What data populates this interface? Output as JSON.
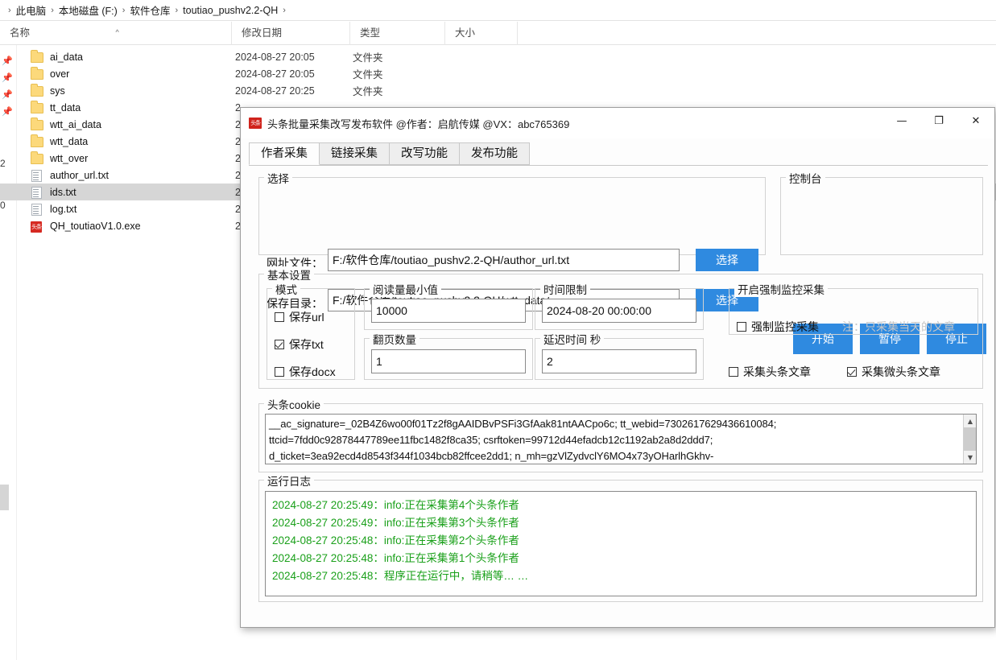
{
  "explorer": {
    "breadcrumb": [
      "此电脑",
      "本地磁盘 (F:)",
      "软件仓库",
      "toutiao_pushv2.2-QH"
    ],
    "columns": [
      {
        "label": "名称",
        "sorted": true
      },
      {
        "label": "修改日期",
        "sorted": false
      },
      {
        "label": "类型",
        "sorted": false
      },
      {
        "label": "大小",
        "sorted": false
      }
    ],
    "left_numbers": [
      "2",
      "0"
    ],
    "files": [
      {
        "name": "ai_data",
        "icon": "folder-icon",
        "date": "2024-08-27 20:05",
        "type": "文件夹",
        "size": "",
        "selected": false
      },
      {
        "name": "over",
        "icon": "folder-icon",
        "date": "2024-08-27 20:05",
        "type": "文件夹",
        "size": "",
        "selected": false
      },
      {
        "name": "sys",
        "icon": "folder-icon",
        "date": "2024-08-27 20:25",
        "type": "文件夹",
        "size": "",
        "selected": false
      },
      {
        "name": "tt_data",
        "icon": "folder-icon",
        "date": "2",
        "type": "",
        "size": "",
        "selected": false
      },
      {
        "name": "wtt_ai_data",
        "icon": "folder-icon",
        "date": "2",
        "type": "",
        "size": "",
        "selected": false
      },
      {
        "name": "wtt_data",
        "icon": "folder-icon",
        "date": "2",
        "type": "",
        "size": "",
        "selected": false
      },
      {
        "name": "wtt_over",
        "icon": "folder-icon",
        "date": "2",
        "type": "",
        "size": "",
        "selected": false
      },
      {
        "name": "author_url.txt",
        "icon": "text-file-icon",
        "date": "2",
        "type": "",
        "size": "",
        "selected": false
      },
      {
        "name": "ids.txt",
        "icon": "text-file-icon",
        "date": "2",
        "type": "",
        "size": "",
        "selected": true
      },
      {
        "name": "log.txt",
        "icon": "text-file-icon",
        "date": "2",
        "type": "",
        "size": "",
        "selected": false
      },
      {
        "name": "QH_toutiaoV1.0.exe",
        "icon": "exe-file-icon",
        "date": "2",
        "type": "",
        "size": "",
        "selected": false
      }
    ]
  },
  "app": {
    "logo_text": "头条",
    "title": "头条批量采集改写发布软件 @作者：启航传媒 @VX：abc765369",
    "window_buttons": {
      "minimize": "—",
      "maximize": "❐",
      "close": "✕"
    },
    "tabs": [
      {
        "label": "作者采集",
        "active": true
      },
      {
        "label": "链接采集",
        "active": false
      },
      {
        "label": "改写功能",
        "active": false
      },
      {
        "label": "发布功能",
        "active": false
      }
    ],
    "select_group": {
      "legend": "选择",
      "url_file_label": "网址文件：",
      "url_file_value": "F:/软件仓库/toutiao_pushv2.2-QH/author_url.txt",
      "url_file_button": "选择",
      "save_dir_label": "保存目录：",
      "save_dir_value": "F:/软件仓库/toutiao_pushv2.2-QH/wtt_data/",
      "save_dir_button": "选择"
    },
    "console_group": {
      "legend": "控制台",
      "start_button": "开始",
      "pause_button": "暂停",
      "stop_button": "停止"
    },
    "basic_group": {
      "legend": "基本设置",
      "mode": {
        "legend": "模式",
        "options": [
          {
            "label": "保存url",
            "checked": false
          },
          {
            "label": "保存txt",
            "checked": true
          },
          {
            "label": "保存docx",
            "checked": false
          }
        ]
      },
      "min_read": {
        "legend": "阅读量最小值",
        "value": "10000"
      },
      "time_limit": {
        "legend": "时间限制",
        "value": "2024-08-20 00:00:00"
      },
      "page_count": {
        "legend": "翻页数量",
        "value": "1"
      },
      "delay_sec": {
        "legend": "延迟时间 秒",
        "value": "2"
      },
      "monitor": {
        "legend": "开启强制监控采集",
        "checkbox_label": "强制监控采集",
        "checkbox_checked": false,
        "note": "注：只采集当天的文章"
      },
      "collect_toutiao": {
        "label": "采集头条文章",
        "checked": false
      },
      "collect_weitoutiao": {
        "label": "采集微头条文章",
        "checked": true
      }
    },
    "cookie_group": {
      "legend": "头条cookie",
      "lines": [
        "__ac_signature=_02B4Z6wo00f01Tz2f8gAAIDBvPSFi3GfAak81ntAACpo6c; tt_webid=7302617629436610084;",
        "ttcid=7fdd0c92878447789ee11fbc1482f8ca35; csrftoken=99712d44efadcb12c1192ab2a8d2ddd7;",
        "d_ticket=3ea92ecd4d8543f344f1034bcb82ffcee2dd1; n_mh=gzVlZydvclY6MO4x73yOHarlhGkhv-"
      ]
    },
    "log_group": {
      "legend": "运行日志",
      "color": "#1aa01a",
      "lines": [
        "2024-08-27 20:25:49：info:正在采集第4个头条作者",
        "2024-08-27 20:25:49：info:正在采集第3个头条作者",
        "2024-08-27 20:25:48：info:正在采集第2个头条作者",
        "2024-08-27 20:25:48：info:正在采集第1个头条作者",
        "2024-08-27 20:25:48：程序正在运行中，请稍等… …"
      ]
    }
  }
}
